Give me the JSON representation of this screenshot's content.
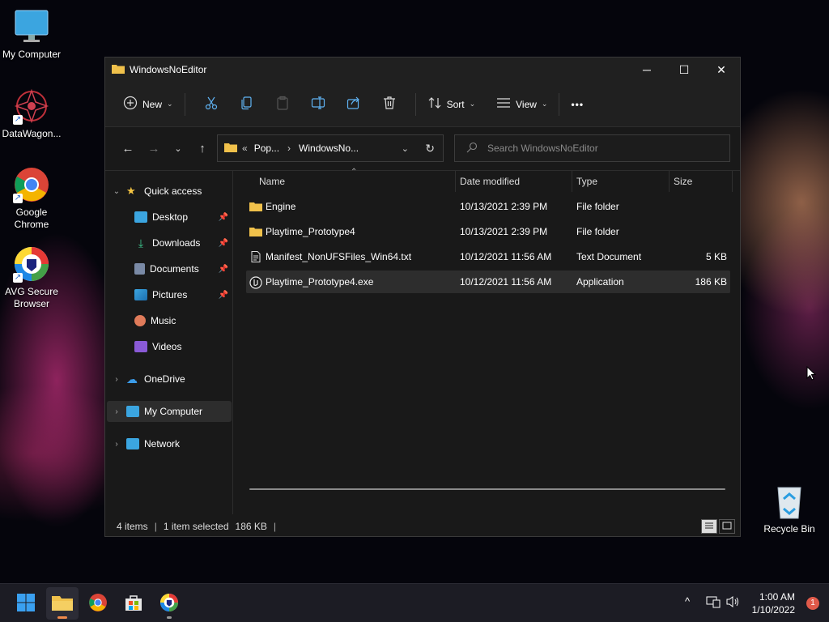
{
  "desktop": {
    "icons": [
      {
        "label": "My Computer",
        "icon": "monitor-icon"
      },
      {
        "label": "DataWagon...",
        "icon": "datawagon-icon"
      },
      {
        "label": "Google Chrome",
        "icon": "chrome-icon"
      },
      {
        "label": "AVG Secure Browser",
        "icon": "avg-browser-icon"
      },
      {
        "label": "Recycle Bin",
        "icon": "recycle-bin-icon"
      }
    ]
  },
  "window": {
    "title": "WindowsNoEditor",
    "controls": {
      "minimize": "─",
      "maximize": "☐",
      "close": "✕"
    },
    "toolbar": {
      "new_label": "New",
      "sort_label": "Sort",
      "view_label": "View",
      "more_label": "•••"
    },
    "address": {
      "prefix": "«",
      "crumbs": [
        "Pop...",
        "WindowsNo..."
      ],
      "separator": "›"
    },
    "search": {
      "placeholder": "Search WindowsNoEditor"
    },
    "nav": {
      "quick_access": "Quick access",
      "quick_items": [
        {
          "label": "Desktop",
          "icon": "desktop-icon",
          "pinned": true
        },
        {
          "label": "Downloads",
          "icon": "download-icon",
          "pinned": true
        },
        {
          "label": "Documents",
          "icon": "documents-icon",
          "pinned": true
        },
        {
          "label": "Pictures",
          "icon": "pictures-icon",
          "pinned": true
        },
        {
          "label": "Music",
          "icon": "music-icon",
          "pinned": false
        },
        {
          "label": "Videos",
          "icon": "videos-icon",
          "pinned": false
        }
      ],
      "onedrive": "OneDrive",
      "my_computer": "My Computer",
      "network": "Network"
    },
    "columns": {
      "name": "Name",
      "date": "Date modified",
      "type": "Type",
      "size": "Size"
    },
    "files": [
      {
        "name": "Engine",
        "date": "10/13/2021 2:39 PM",
        "type": "File folder",
        "size": "",
        "icon": "folder-icon",
        "selected": false
      },
      {
        "name": "Playtime_Prototype4",
        "date": "10/13/2021 2:39 PM",
        "type": "File folder",
        "size": "",
        "icon": "folder-icon",
        "selected": false
      },
      {
        "name": "Manifest_NonUFSFiles_Win64.txt",
        "date": "10/12/2021 11:56 AM",
        "type": "Text Document",
        "size": "5 KB",
        "icon": "text-file-icon",
        "selected": false
      },
      {
        "name": "Playtime_Prototype4.exe",
        "date": "10/12/2021 11:56 AM",
        "type": "Application",
        "size": "186 KB",
        "icon": "unreal-exe-icon",
        "selected": true
      }
    ],
    "status": {
      "items": "4 items",
      "selected": "1 item selected",
      "size": "186 KB",
      "sep": "|"
    }
  },
  "taskbar": {
    "time": "1:00 AM",
    "date": "1/10/2022",
    "notifications": "1",
    "tray_chevron": "^"
  },
  "colors": {
    "folder": "#f0c14b",
    "accent": "#f08a4b",
    "selected_row": "#2d2d2d"
  }
}
